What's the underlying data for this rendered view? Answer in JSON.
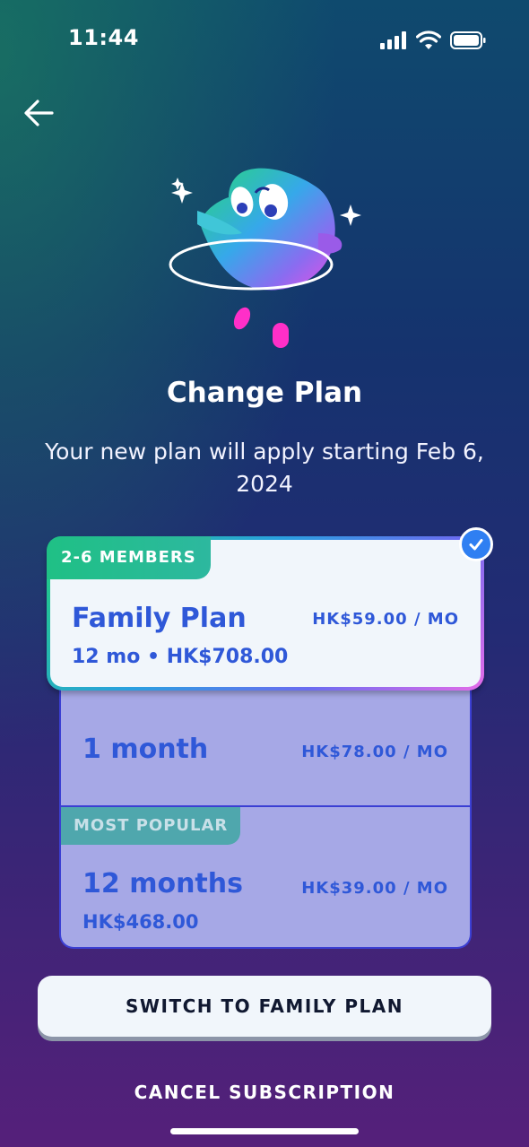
{
  "status_bar": {
    "time": "11:44"
  },
  "header": {
    "back_icon": "arrow-left-icon"
  },
  "title": "Change Plan",
  "subtitle": "Your new plan will apply starting Feb 6, 2024",
  "selected_plan": {
    "badge": "2-6 MEMBERS",
    "name": "Family Plan",
    "detail": "12 mo • HK$708.00",
    "price": "HK$59.00 / MO",
    "selected": true
  },
  "other_plans": [
    {
      "name": "1 month",
      "price": "HK$78.00 / MO"
    },
    {
      "badge": "MOST POPULAR",
      "name": "12 months",
      "detail": "HK$468.00",
      "price": "HK$39.00 / MO"
    }
  ],
  "actions": {
    "switch_label": "SWITCH TO FAMILY PLAN",
    "cancel_label": "CANCEL SUBSCRIPTION"
  },
  "colors": {
    "accent_blue": "#2f58d8",
    "card_bg": "#f1f6fb",
    "plan_bg": "#a6a8e6",
    "badge_green": "#1fc085",
    "check_blue": "#2f7ff2"
  }
}
